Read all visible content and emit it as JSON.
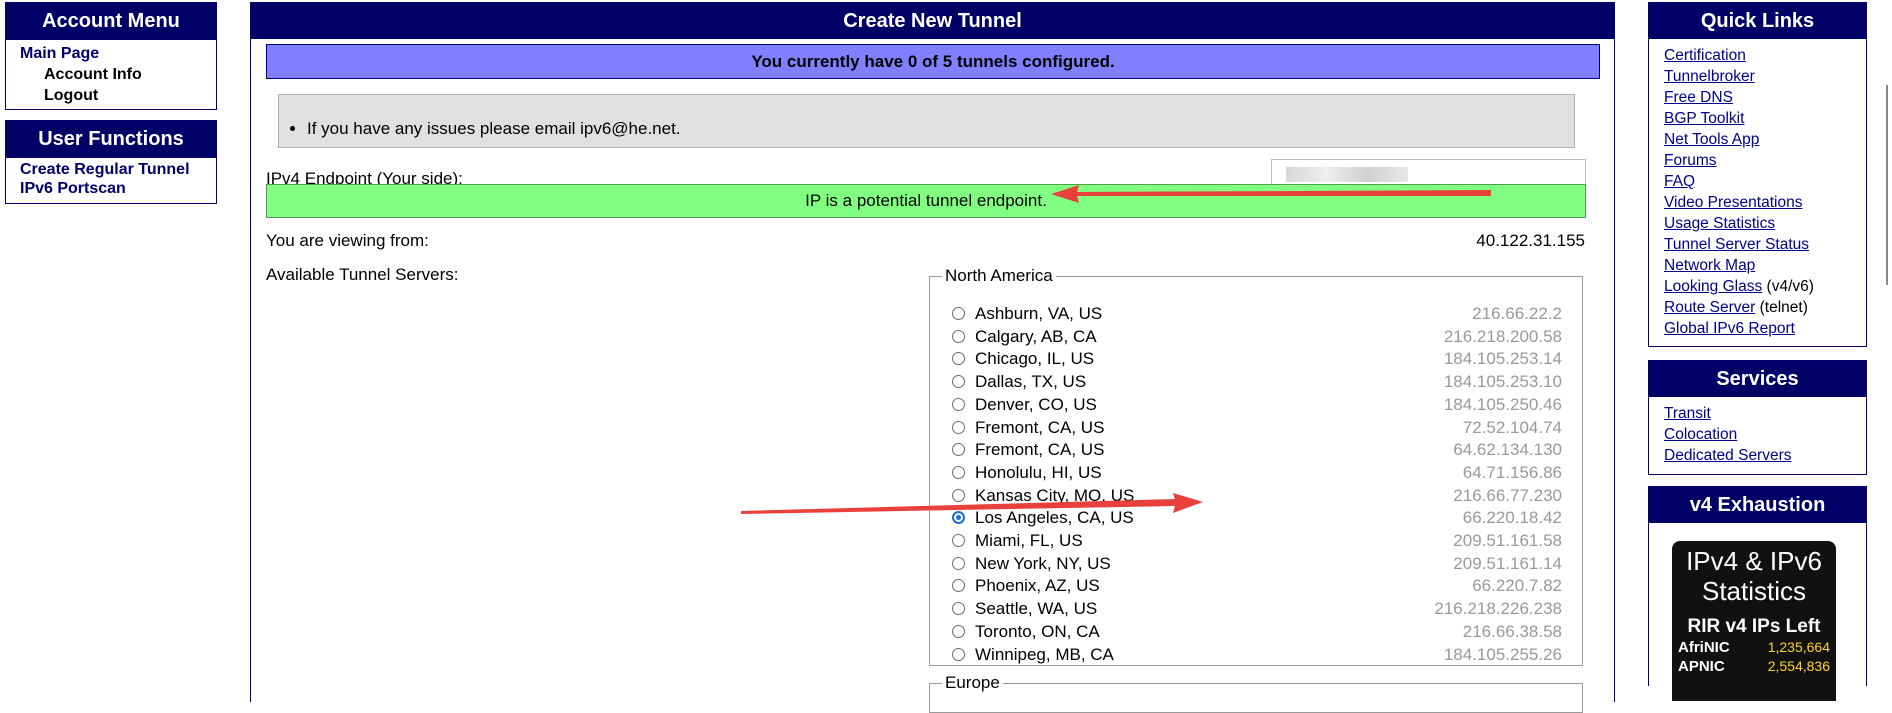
{
  "account_menu": {
    "title": "Account Menu",
    "items": [
      {
        "label": "Main Page"
      },
      {
        "label": "Account Info"
      },
      {
        "label": "Logout"
      }
    ]
  },
  "user_functions": {
    "title": "User Functions",
    "items": [
      {
        "label": "Create Regular Tunnel"
      },
      {
        "label": "IPv6 Portscan"
      }
    ]
  },
  "main": {
    "title": "Create New Tunnel",
    "tunnel_count": "You currently have 0 of 5 tunnels configured.",
    "notice": "If you have any issues please email ipv6@he.net.",
    "endpoint_label": "IPv4 Endpoint (Your side):",
    "endpoint_value": "",
    "endpoint_status": "IP is a potential tunnel endpoint.",
    "viewing_label": "You are viewing from:",
    "viewing_ip": "40.122.31.155",
    "servers_label": "Available Tunnel Servers:",
    "regions": [
      {
        "name": "North America",
        "selected": "Los Angeles, CA, US",
        "servers": [
          {
            "name": "Ashburn, VA, US",
            "ip": "216.66.22.2"
          },
          {
            "name": "Calgary, AB, CA",
            "ip": "216.218.200.58"
          },
          {
            "name": "Chicago, IL, US",
            "ip": "184.105.253.14"
          },
          {
            "name": "Dallas, TX, US",
            "ip": "184.105.253.10"
          },
          {
            "name": "Denver, CO, US",
            "ip": "184.105.250.46"
          },
          {
            "name": "Fremont, CA, US",
            "ip": "72.52.104.74"
          },
          {
            "name": "Fremont, CA, US",
            "ip": "64.62.134.130"
          },
          {
            "name": "Honolulu, HI, US",
            "ip": "64.71.156.86"
          },
          {
            "name": "Kansas City, MO, US",
            "ip": "216.66.77.230"
          },
          {
            "name": "Los Angeles, CA, US",
            "ip": "66.220.18.42"
          },
          {
            "name": "Miami, FL, US",
            "ip": "209.51.161.58"
          },
          {
            "name": "New York, NY, US",
            "ip": "209.51.161.14"
          },
          {
            "name": "Phoenix, AZ, US",
            "ip": "66.220.7.82"
          },
          {
            "name": "Seattle, WA, US",
            "ip": "216.218.226.238"
          },
          {
            "name": "Toronto, ON, CA",
            "ip": "216.66.38.58"
          },
          {
            "name": "Winnipeg, MB, CA",
            "ip": "184.105.255.26"
          }
        ]
      },
      {
        "name": "Europe"
      }
    ]
  },
  "quick_links": {
    "title": "Quick Links",
    "items": [
      {
        "label": "Certification"
      },
      {
        "label": "Tunnelbroker"
      },
      {
        "label": "Free DNS"
      },
      {
        "label": "BGP Toolkit"
      },
      {
        "label": "Net Tools App"
      },
      {
        "label": "Forums"
      },
      {
        "label": "FAQ"
      },
      {
        "label": "Video Presentations"
      },
      {
        "label": "Usage Statistics"
      },
      {
        "label": "Tunnel Server Status"
      },
      {
        "label": "Network Map"
      },
      {
        "label": "Looking Glass",
        "suffix": " (v4/v6)"
      },
      {
        "label": "Route Server",
        "suffix": " (telnet)"
      },
      {
        "label": "Global IPv6 Report"
      }
    ]
  },
  "services": {
    "title": "Services",
    "items": [
      {
        "label": "Transit"
      },
      {
        "label": "Colocation"
      },
      {
        "label": "Dedicated Servers"
      }
    ]
  },
  "v4_exhaustion": {
    "title": "v4 Exhaustion",
    "image": {
      "headline": "IPv4 & IPv6 Statistics",
      "subhead": "RIR v4 IPs Left",
      "rows": [
        {
          "rir": "AfriNIC",
          "count": "1,235,664"
        },
        {
          "rir": "APNIC",
          "count": "2,554,836"
        }
      ]
    }
  },
  "colors": {
    "header_bg": "#000066",
    "count_bar": "#8080ff",
    "status_ok": "#80ff80",
    "notice_bg": "#e0e0e0",
    "arrow": "#e8413c",
    "radio_selected": "#1a6fd6"
  }
}
